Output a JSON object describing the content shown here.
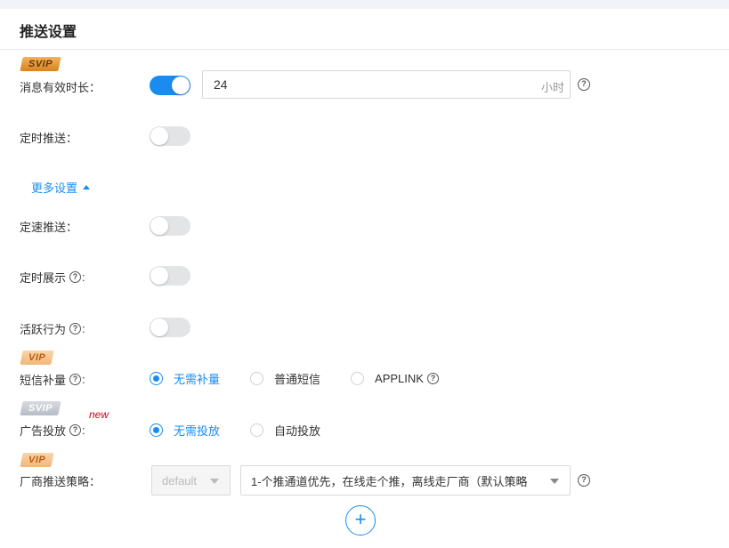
{
  "section": {
    "title": "推送设置"
  },
  "badges": {
    "svip": "SVIP",
    "vip": "VIP"
  },
  "msg_valid": {
    "label": "消息有效时长：",
    "enabled": true,
    "value": "24",
    "unit": "小时"
  },
  "scheduled_push": {
    "label": "定时推送：",
    "enabled": false
  },
  "more_settings": {
    "label": "更多设置"
  },
  "rate_push": {
    "label": "定速推送：",
    "enabled": false
  },
  "scheduled_display": {
    "label": "定时展示",
    "colon": ":",
    "enabled": false
  },
  "active_behavior": {
    "label": "活跃行为",
    "colon": ":",
    "enabled": false
  },
  "sms_supplement": {
    "label": "短信补量",
    "colon": ":",
    "options": [
      "无需补量",
      "普通短信",
      "APPLINK"
    ],
    "selected": "无需补量"
  },
  "ad_delivery": {
    "new_tag": "new",
    "label": "广告投放",
    "colon": ":",
    "options": [
      "无需投放",
      "自动投放"
    ],
    "selected": "无需投放"
  },
  "vendor_strategy": {
    "label": "厂商推送策略：",
    "select1": "default",
    "select2": "1-个推通道优先，在线走个推，离线走厂商（默认策略"
  },
  "icons": {
    "help": "question-circle-icon",
    "add": "plus-circle-icon",
    "caret": "caret-up-icon",
    "dropdown": "caret-down-icon"
  },
  "colors": {
    "accent": "#1a8cf0",
    "new_tag": "#d0021b",
    "svip_badge": "#e0902f",
    "vip_badge": "#f6c792"
  }
}
